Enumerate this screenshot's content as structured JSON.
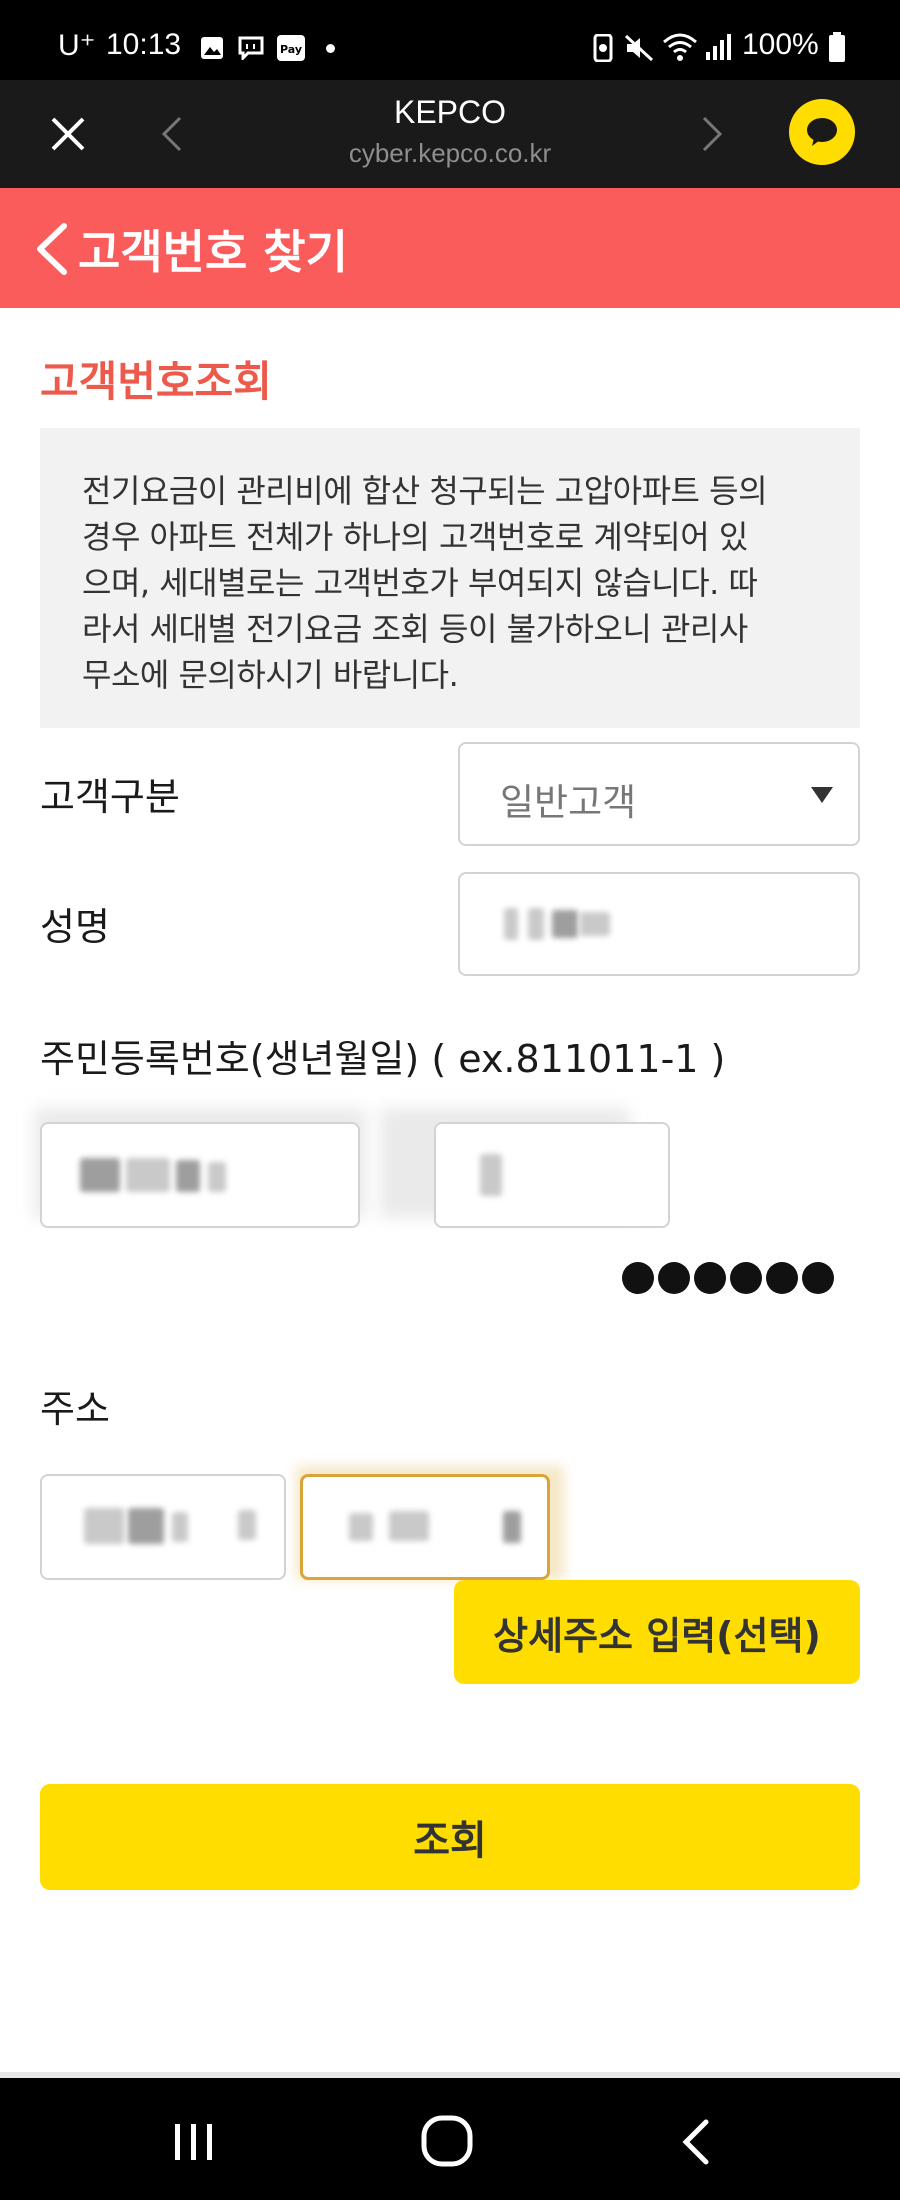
{
  "status_bar": {
    "carrier": "U⁺",
    "time": "10:13",
    "battery": "100%",
    "icons": [
      "gallery-icon",
      "message-icon",
      "pay-icon",
      "dot-icon",
      "recycle-icon",
      "mute-icon",
      "wifi-icon",
      "signal-icon",
      "battery-icon"
    ]
  },
  "browser": {
    "title": "KEPCO",
    "url": "cyber.kepco.co.kr",
    "icons": [
      "close-icon",
      "back-icon",
      "forward-icon",
      "kakaotalk-icon"
    ]
  },
  "header": {
    "title": "고객번호 찾기",
    "back_icon": "chevron-left-icon"
  },
  "section_title": "고객번호조회",
  "notice": {
    "lines": [
      "전기요금이 관리비에 합산 청구되는 고압아파트 등의",
      "경우 아파트 전체가 하나의 고객번호로 계약되어 있",
      "으며, 세대별로는 고객번호가 부여되지 않습니다. 따",
      "라서 세대별 전기요금 조회 등이 불가하오니 관리사",
      "무소에 문의하시기 바랍니다."
    ]
  },
  "form": {
    "customer_type_label": "고객구분",
    "customer_type_value": "일반고객",
    "name_label": "성명",
    "rrn_label": "주민등록번호(생년월일) ( ex.811011-1 )",
    "masked_dots": 6,
    "address_label": "주소",
    "detail_address_button": "상세주소 입력(선택)",
    "search_button": "조회"
  },
  "nav_bar": {
    "icons": [
      "recent-apps-icon",
      "home-icon",
      "back-icon"
    ]
  },
  "colors": {
    "header_red": "#fa5c5c",
    "section_red": "#ec5a4c",
    "button_yellow": "#ffdd00",
    "focus_border": "#d9a53a"
  }
}
